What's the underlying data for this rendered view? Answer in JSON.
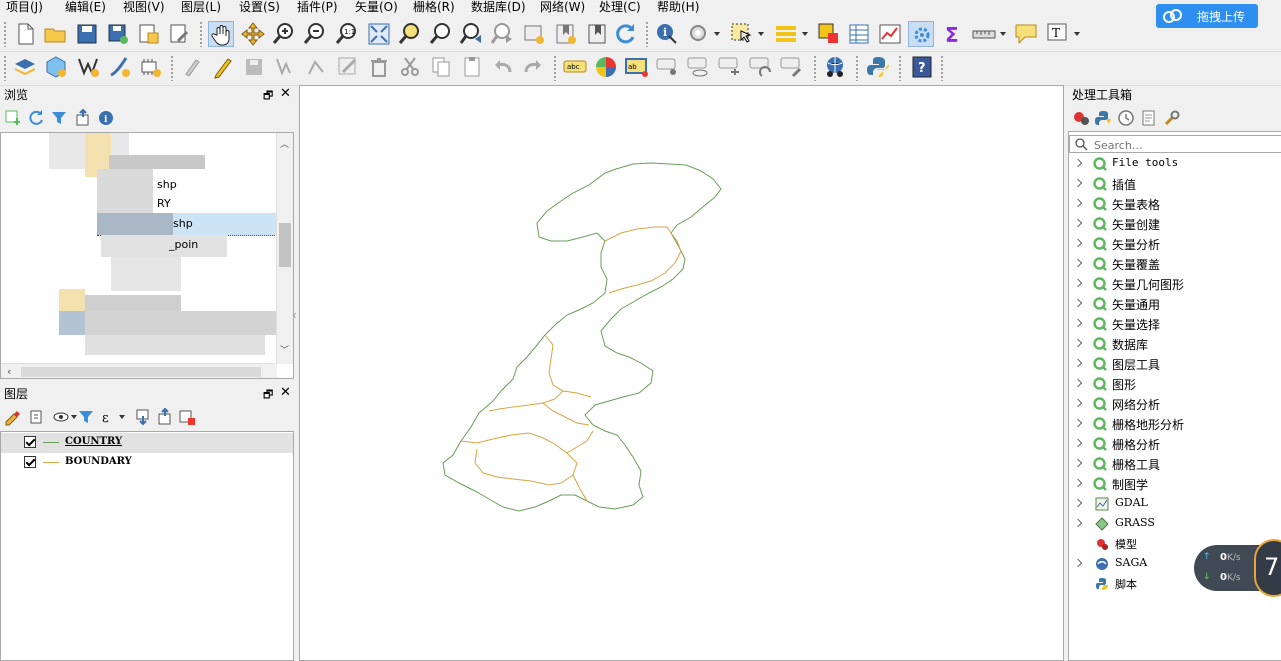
{
  "menu": [
    {
      "id": "project",
      "label": "项目(J)"
    },
    {
      "id": "edit",
      "label": "编辑(E)"
    },
    {
      "id": "view",
      "label": "视图(V)"
    },
    {
      "id": "layer",
      "label": "图层(L)"
    },
    {
      "id": "settings",
      "label": "设置(S)"
    },
    {
      "id": "plugins",
      "label": "插件(P)"
    },
    {
      "id": "vector",
      "label": "矢量(O)"
    },
    {
      "id": "raster",
      "label": "栅格(R)"
    },
    {
      "id": "database",
      "label": "数据库(D)"
    },
    {
      "id": "web",
      "label": "网络(W)"
    },
    {
      "id": "processing",
      "label": "处理(C)"
    },
    {
      "id": "help",
      "label": "帮助(H)"
    }
  ],
  "upload_button": {
    "label": "拖拽上传"
  },
  "browser_panel": {
    "title": "浏览",
    "items": [
      "shp",
      "RY",
      "shp",
      "_poin"
    ]
  },
  "layers_panel": {
    "title": "图层",
    "layers": [
      {
        "name": "COUNTRY",
        "checked": true,
        "color": "#6a9f58",
        "selected": true
      },
      {
        "name": "BOUNDARY",
        "checked": true,
        "color": "#d9a441",
        "selected": false
      }
    ]
  },
  "processing_panel": {
    "title": "处理工具箱",
    "search_placeholder": "Search…",
    "items": [
      {
        "label": "File tools",
        "icon": "q",
        "expand": true
      },
      {
        "label": "插值",
        "icon": "q",
        "expand": true
      },
      {
        "label": "矢量表格",
        "icon": "q",
        "expand": true
      },
      {
        "label": "矢量创建",
        "icon": "q",
        "expand": true
      },
      {
        "label": "矢量分析",
        "icon": "q",
        "expand": true
      },
      {
        "label": "矢量覆盖",
        "icon": "q",
        "expand": true
      },
      {
        "label": "矢量几何图形",
        "icon": "q",
        "expand": true
      },
      {
        "label": "矢量通用",
        "icon": "q",
        "expand": true
      },
      {
        "label": "矢量选择",
        "icon": "q",
        "expand": true
      },
      {
        "label": "数据库",
        "icon": "q",
        "expand": true
      },
      {
        "label": "图层工具",
        "icon": "q",
        "expand": true
      },
      {
        "label": "图形",
        "icon": "q",
        "expand": true
      },
      {
        "label": "网络分析",
        "icon": "q",
        "expand": true
      },
      {
        "label": "栅格地形分析",
        "icon": "q",
        "expand": true
      },
      {
        "label": "栅格分析",
        "icon": "q",
        "expand": true
      },
      {
        "label": "栅格工具",
        "icon": "q",
        "expand": true
      },
      {
        "label": "制图学",
        "icon": "q",
        "expand": true
      },
      {
        "label": "GDAL",
        "icon": "gdal",
        "expand": true
      },
      {
        "label": "GRASS",
        "icon": "grass",
        "expand": true
      },
      {
        "label": "模型",
        "icon": "model",
        "expand": false
      },
      {
        "label": "SAGA",
        "icon": "saga",
        "expand": true
      },
      {
        "label": "脚本",
        "icon": "python",
        "expand": false
      }
    ]
  },
  "speed_widget": {
    "up": "0",
    "down": "0",
    "unit": "K/s",
    "badge": "7"
  },
  "colors": {
    "country": "#6a9f58",
    "boundary": "#d9a441",
    "accent": "#2f8ff0"
  }
}
